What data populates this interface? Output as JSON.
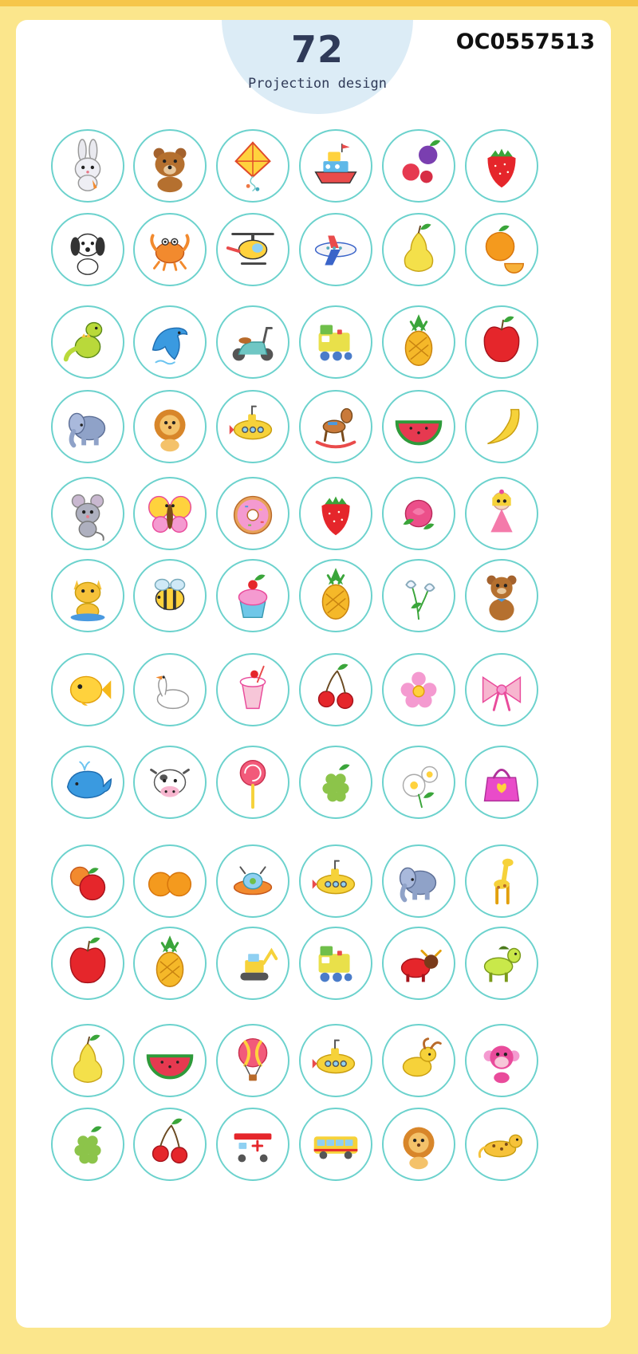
{
  "header": {
    "count": "72",
    "caption": "Projection design",
    "product_code": "OC0557513"
  },
  "colors": {
    "background": "#fbe68c",
    "card": "#ffffff",
    "bubble": "#dcecf6",
    "ring": "#6cd2cd",
    "title_text": "#2f3a58"
  },
  "projection_patterns": [
    [
      "rabbit-icon",
      "bear-icon",
      "kite-icon",
      "boat-icon",
      "berries-icon",
      "strawberry-icon"
    ],
    [
      "puppy-icon",
      "crab-icon",
      "helicopter-icon",
      "airplane-icon",
      "pear-icon",
      "orange-icon"
    ],
    [
      "dinosaur-icon",
      "dolphin-icon",
      "scooter-icon",
      "train-icon",
      "pineapple-icon",
      "apple-icon"
    ],
    [
      "elephant-icon",
      "lion-icon",
      "submarine-icon",
      "rocking-horse-icon",
      "watermelon-icon",
      "banana-icon"
    ],
    [
      "mouse-icon",
      "butterfly-icon",
      "donut-icon",
      "strawberry-icon",
      "rose-icon",
      "doll-icon"
    ],
    [
      "cat-icon",
      "bee-icon",
      "cupcake-icon",
      "pineapple-icon",
      "lily-icon",
      "teddy-bear-icon"
    ],
    [
      "fish-icon",
      "swan-icon",
      "milkshake-icon",
      "cherries-icon",
      "flower-icon",
      "bow-icon"
    ],
    [
      "whale-icon",
      "cow-icon",
      "lollipop-icon",
      "grapes-icon",
      "daisy-icon",
      "handbag-icon"
    ],
    [
      "tomatoes-icon",
      "oranges-icon",
      "ufo-icon",
      "submarine-icon",
      "elephant-icon",
      "giraffe-icon"
    ],
    [
      "apple-icon",
      "pineapple-icon",
      "excavator-icon",
      "train-icon",
      "bull-icon",
      "horse-icon"
    ],
    [
      "pear-icon",
      "watermelon-icon",
      "hot-air-balloon-icon",
      "submarine-icon",
      "goat-icon",
      "monkey-icon"
    ],
    [
      "grapes-icon",
      "cherries-icon",
      "ambulance-icon",
      "bus-icon",
      "lion-icon",
      "leopard-icon"
    ]
  ]
}
